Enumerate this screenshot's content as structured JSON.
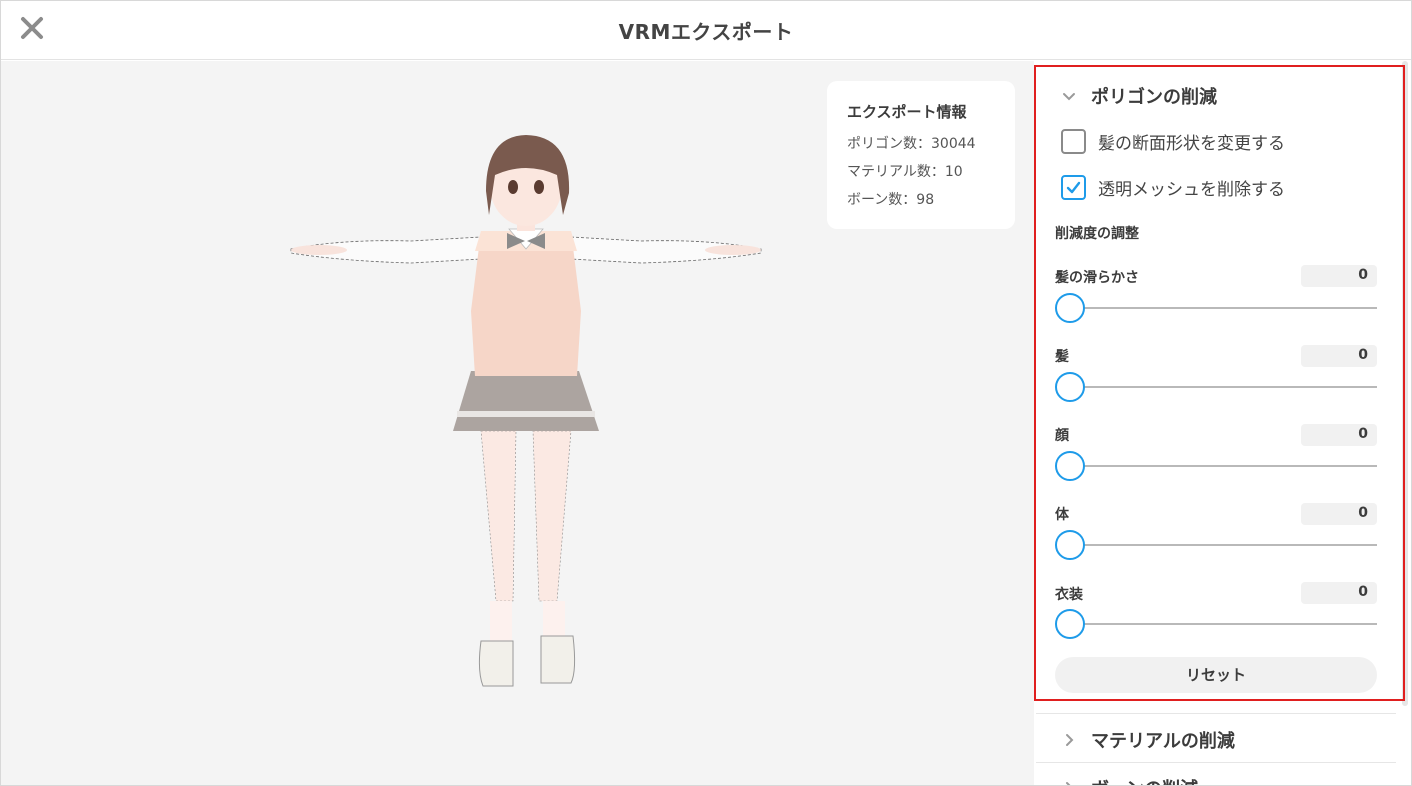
{
  "header": {
    "title": "VRMエクスポート",
    "close_icon": "close-icon"
  },
  "export_info": {
    "title": "エクスポート情報",
    "polygons": "ポリゴン数：30044",
    "materials": "マテリアル数：10",
    "bones": "ボーン数：98"
  },
  "polygon_section": {
    "title": "ポリゴンの削減",
    "expanded": true,
    "options": [
      {
        "label": "髪の断面形状を変更する",
        "checked": false
      },
      {
        "label": "透明メッシュを削除する",
        "checked": true
      }
    ],
    "adjust_title": "削減度の調整",
    "sliders": [
      {
        "label": "髪の滑らかさ",
        "value": "0",
        "level": 0
      },
      {
        "label": "髪",
        "value": "0",
        "level": 0
      },
      {
        "label": "顔",
        "value": "0",
        "level": 0
      },
      {
        "label": "体",
        "value": "0",
        "level": 0
      },
      {
        "label": "衣装",
        "value": "0",
        "level": 0
      }
    ],
    "reset_label": "リセット"
  },
  "collapsed_sections": [
    {
      "title": "マテリアルの削減"
    },
    {
      "title": "ボーンの削減"
    }
  ],
  "colors": {
    "accent": "#1e9be9",
    "highlight": "#e01f1f",
    "viewport_bg": "#f4f4f4"
  }
}
